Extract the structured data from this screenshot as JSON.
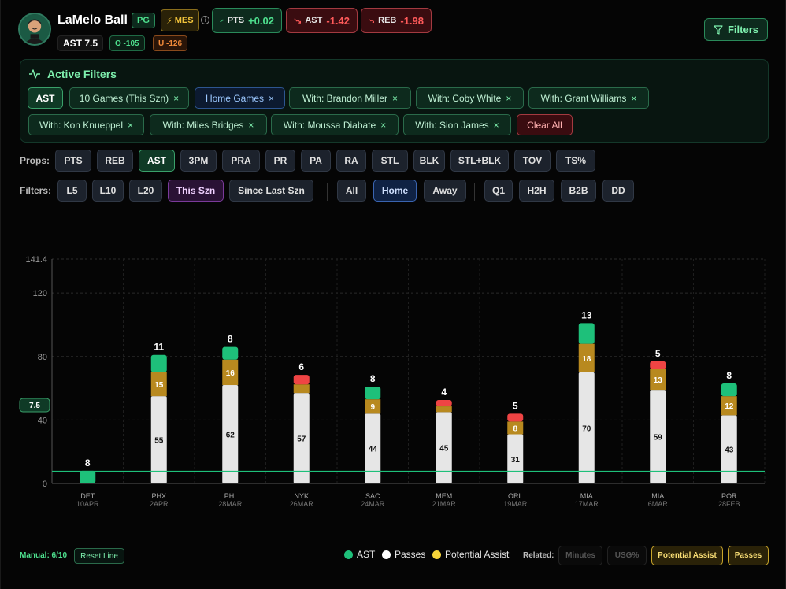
{
  "header": {
    "player_name": "LaMelo Ball",
    "position": "PG",
    "badge": "MES",
    "trends": [
      {
        "label": "PTS",
        "value": "+0.02",
        "direction": "up",
        "color": "#4ee08e"
      },
      {
        "label": "AST",
        "value": "-1.42",
        "direction": "down",
        "color": "#ff5a5a"
      },
      {
        "label": "REB",
        "value": "-1.98",
        "direction": "down",
        "color": "#ff5a5a"
      }
    ],
    "line": "AST 7.5",
    "over": "O -105",
    "under": "U -126",
    "filters_button": "Filters"
  },
  "active_filters": {
    "title": "Active Filters",
    "chips": [
      {
        "label": "AST",
        "style": "strong",
        "removable": false
      },
      {
        "label": "10 Games (This Szn)",
        "style": "green",
        "removable": true
      },
      {
        "label": "Home Games",
        "style": "blue",
        "removable": true
      },
      {
        "label": "With: Brandon Miller",
        "style": "green",
        "removable": true
      },
      {
        "label": "With: Coby White",
        "style": "green",
        "removable": true
      },
      {
        "label": "With: Grant Williams",
        "style": "green",
        "removable": true
      },
      {
        "label": "With: Kon Knueppel",
        "style": "green",
        "removable": true
      },
      {
        "label": "With: Miles Bridges",
        "style": "green",
        "removable": true
      },
      {
        "label": "With: Moussa Diabate",
        "style": "green",
        "removable": true
      },
      {
        "label": "With: Sion James",
        "style": "green",
        "removable": true
      }
    ],
    "clear_all": "Clear All",
    "remove_glyph": "×"
  },
  "props": {
    "label": "Props:",
    "items": [
      "PTS",
      "REB",
      "AST",
      "3PM",
      "PRA",
      "PR",
      "PA",
      "RA",
      "STL",
      "BLK",
      "STL+BLK",
      "TOV",
      "TS%"
    ],
    "selected": "AST"
  },
  "filters": {
    "label": "Filters:",
    "range": [
      "L5",
      "L10",
      "L20",
      "This Szn",
      "Since Last Szn"
    ],
    "range_selected": "This Szn",
    "location": [
      "All",
      "Home",
      "Away"
    ],
    "location_selected": "Home",
    "situation": [
      "Q1",
      "H2H",
      "B2B",
      "DD"
    ]
  },
  "chart_data": {
    "type": "bar",
    "stacked": true,
    "categories": [
      "DET",
      "PHX",
      "PHI",
      "NYK",
      "SAC",
      "MEM",
      "ORL",
      "MIA",
      "MIA",
      "POR"
    ],
    "dates": [
      "10APR",
      "2APR",
      "28MAR",
      "26MAR",
      "24MAR",
      "21MAR",
      "19MAR",
      "17MAR",
      "6MAR",
      "28FEB"
    ],
    "totals": [
      8,
      11,
      8,
      6,
      8,
      4,
      5,
      13,
      5,
      8
    ],
    "hit_line": [
      true,
      true,
      true,
      false,
      true,
      false,
      false,
      true,
      false,
      true
    ],
    "series": [
      {
        "name": "Passes",
        "color": "#e6e6e6",
        "values": [
          null,
          55,
          62,
          57,
          44,
          45,
          31,
          70,
          59,
          43
        ]
      },
      {
        "name": "Potential Assist",
        "color": "#b8891f",
        "values": [
          null,
          15,
          16,
          null,
          9,
          null,
          8,
          18,
          13,
          12
        ]
      },
      {
        "name": "AST",
        "color": "#1ec07a",
        "values": [
          8,
          11,
          8,
          6,
          8,
          4,
          5,
          13,
          5,
          8
        ]
      }
    ],
    "yticks": [
      0,
      40,
      80,
      120,
      141.4
    ],
    "ylim": [
      0,
      141.4
    ],
    "line_value": 7.5,
    "line_label": "7.5",
    "grid": true,
    "colors": {
      "hit": "#1ec07a",
      "miss": "#ef4444",
      "passes": "#e6e6e6",
      "potential": "#b8891f",
      "line": "#1ec07a"
    }
  },
  "footer": {
    "manual": "Manual: 6/10",
    "reset": "Reset Line",
    "legend": [
      {
        "label": "AST",
        "color": "#1ec07a"
      },
      {
        "label": "Passes",
        "color": "#ffffff"
      },
      {
        "label": "Potential Assist",
        "color": "#f7d53a"
      }
    ],
    "related_label": "Related:",
    "related": [
      {
        "label": "Minutes",
        "active": false
      },
      {
        "label": "USG%",
        "active": false
      },
      {
        "label": "Potential Assist",
        "active": true
      },
      {
        "label": "Passes",
        "active": true
      }
    ]
  }
}
